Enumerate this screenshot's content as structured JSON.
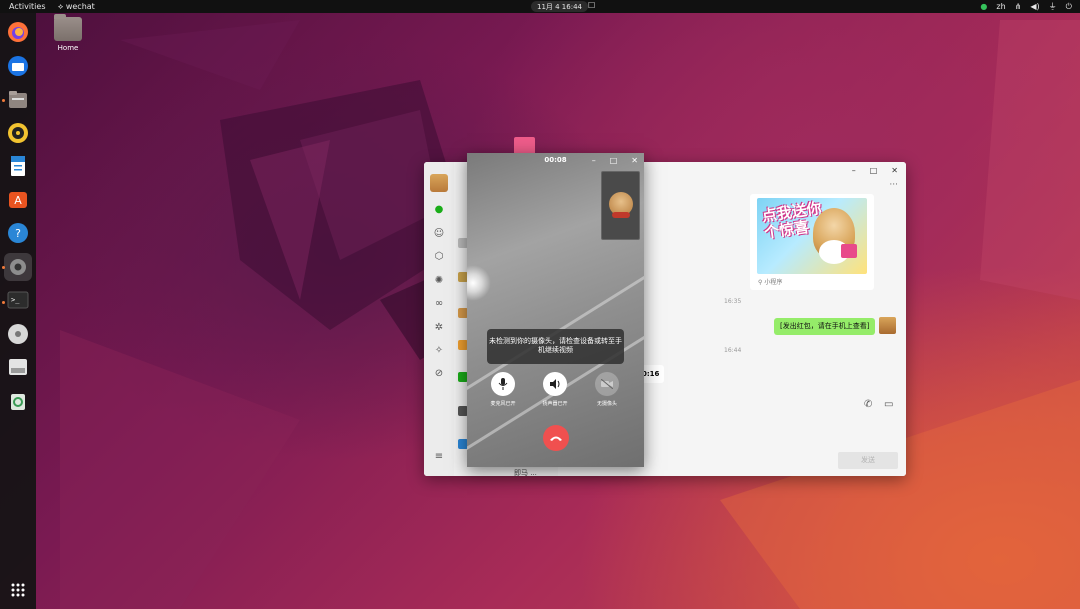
{
  "topbar": {
    "activities": "Activities",
    "app_name": "wechat",
    "clock": "11月 4  16:44",
    "lang": "zh"
  },
  "desktop": {
    "home_label": "Home"
  },
  "wechat": {
    "sticker_caption": "小程序",
    "sticker_text": "点我送你个惊喜",
    "time_1": "16:35",
    "time_2": "16:44",
    "my_message": "[发出红包，请在手机上查看]",
    "partial_message": "0:16",
    "send_label": "发送",
    "list_last": "即马 ..."
  },
  "video_call": {
    "timer": "00:08",
    "notice": "未检测到你的摄像头，请检查设备或转至手机继续视频",
    "mic_label": "麦克风已开",
    "speaker_label": "扬声器已开",
    "camera_label": "无摄像头"
  },
  "colors": {
    "wechat_green": "#95ec69",
    "hangup_red": "#f0504f",
    "dock_bg": "#141414"
  }
}
